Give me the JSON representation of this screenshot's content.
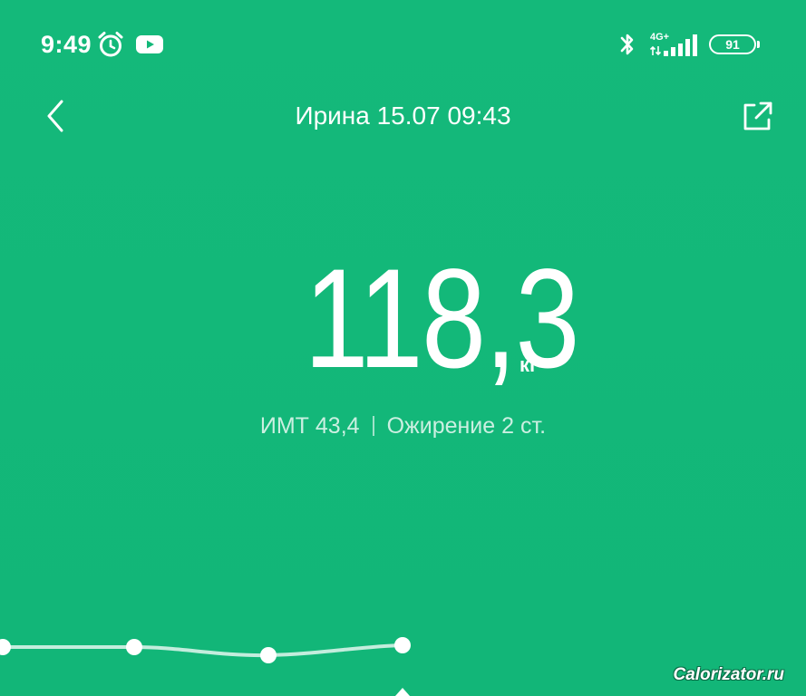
{
  "status_bar": {
    "time": "9:49",
    "network": "4G+",
    "battery": "91",
    "icons": [
      "alarm-clock-icon",
      "youtube-icon",
      "bluetooth-icon",
      "data-arrows-icon",
      "signal-icon",
      "battery-icon"
    ]
  },
  "header": {
    "title": "Ирина 15.07 09:43",
    "back_icon": "chevron-left-icon",
    "share_icon": "share-icon"
  },
  "measurement": {
    "weight": "118,3",
    "unit": "кг",
    "bmi": "ИМТ 43,4",
    "category": "Ожирение 2 ст."
  },
  "watermark": "Calorizator.ru",
  "colors": {
    "background": "#13b879",
    "text": "#ffffff"
  }
}
